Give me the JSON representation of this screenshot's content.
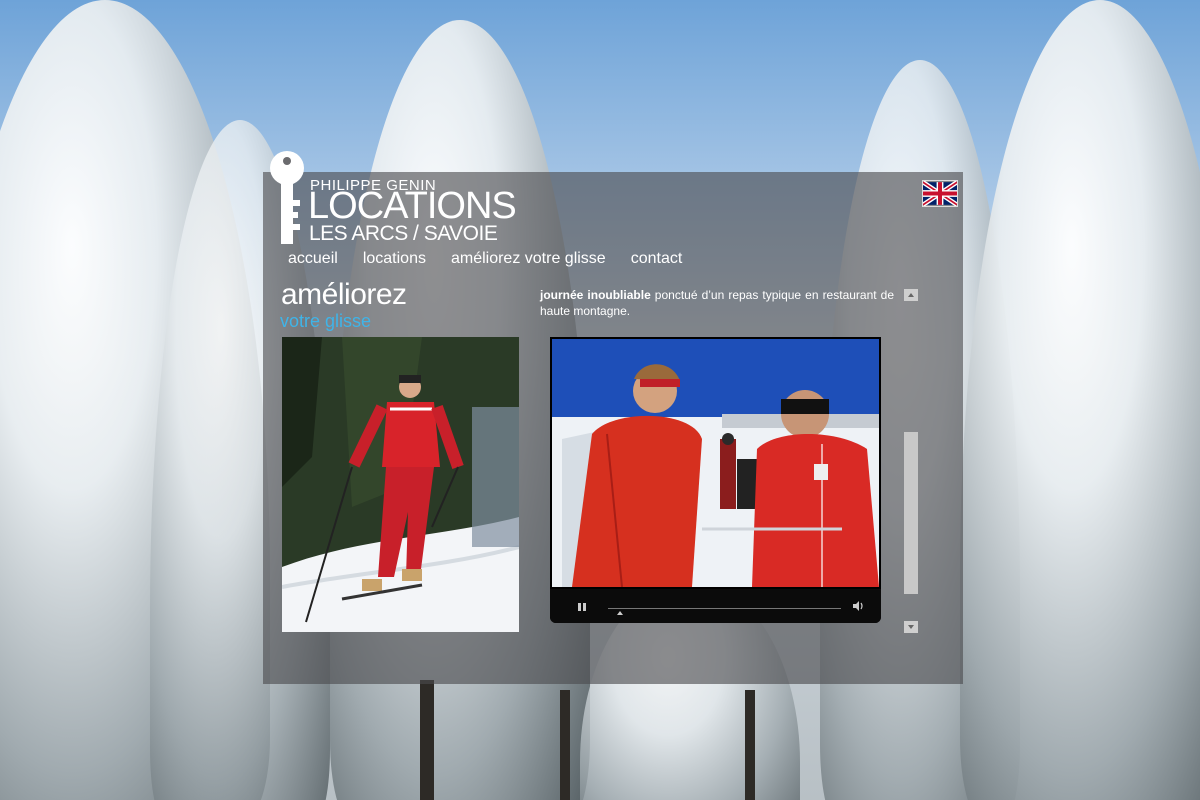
{
  "logo": {
    "line1": "PHILIPPE GENIN",
    "line2": "LOCATIONS",
    "line3": "LES ARCS / SAVOIE"
  },
  "language_flag": "uk-flag-icon",
  "nav": {
    "items": [
      "accueil",
      "locations",
      "améliorez votre glisse",
      "contact"
    ]
  },
  "heading": {
    "title": "améliorez",
    "subtitle": "votre glisse"
  },
  "content": {
    "bold_lead": "journée inoubliable",
    "text": " ponctué d’un repas typique en restaurant de haute montagne."
  },
  "video": {
    "play_state": "pause-icon",
    "volume": "volume-icon"
  },
  "colors": {
    "accent": "#3fb4e8",
    "panel": "#4b4b4e"
  }
}
